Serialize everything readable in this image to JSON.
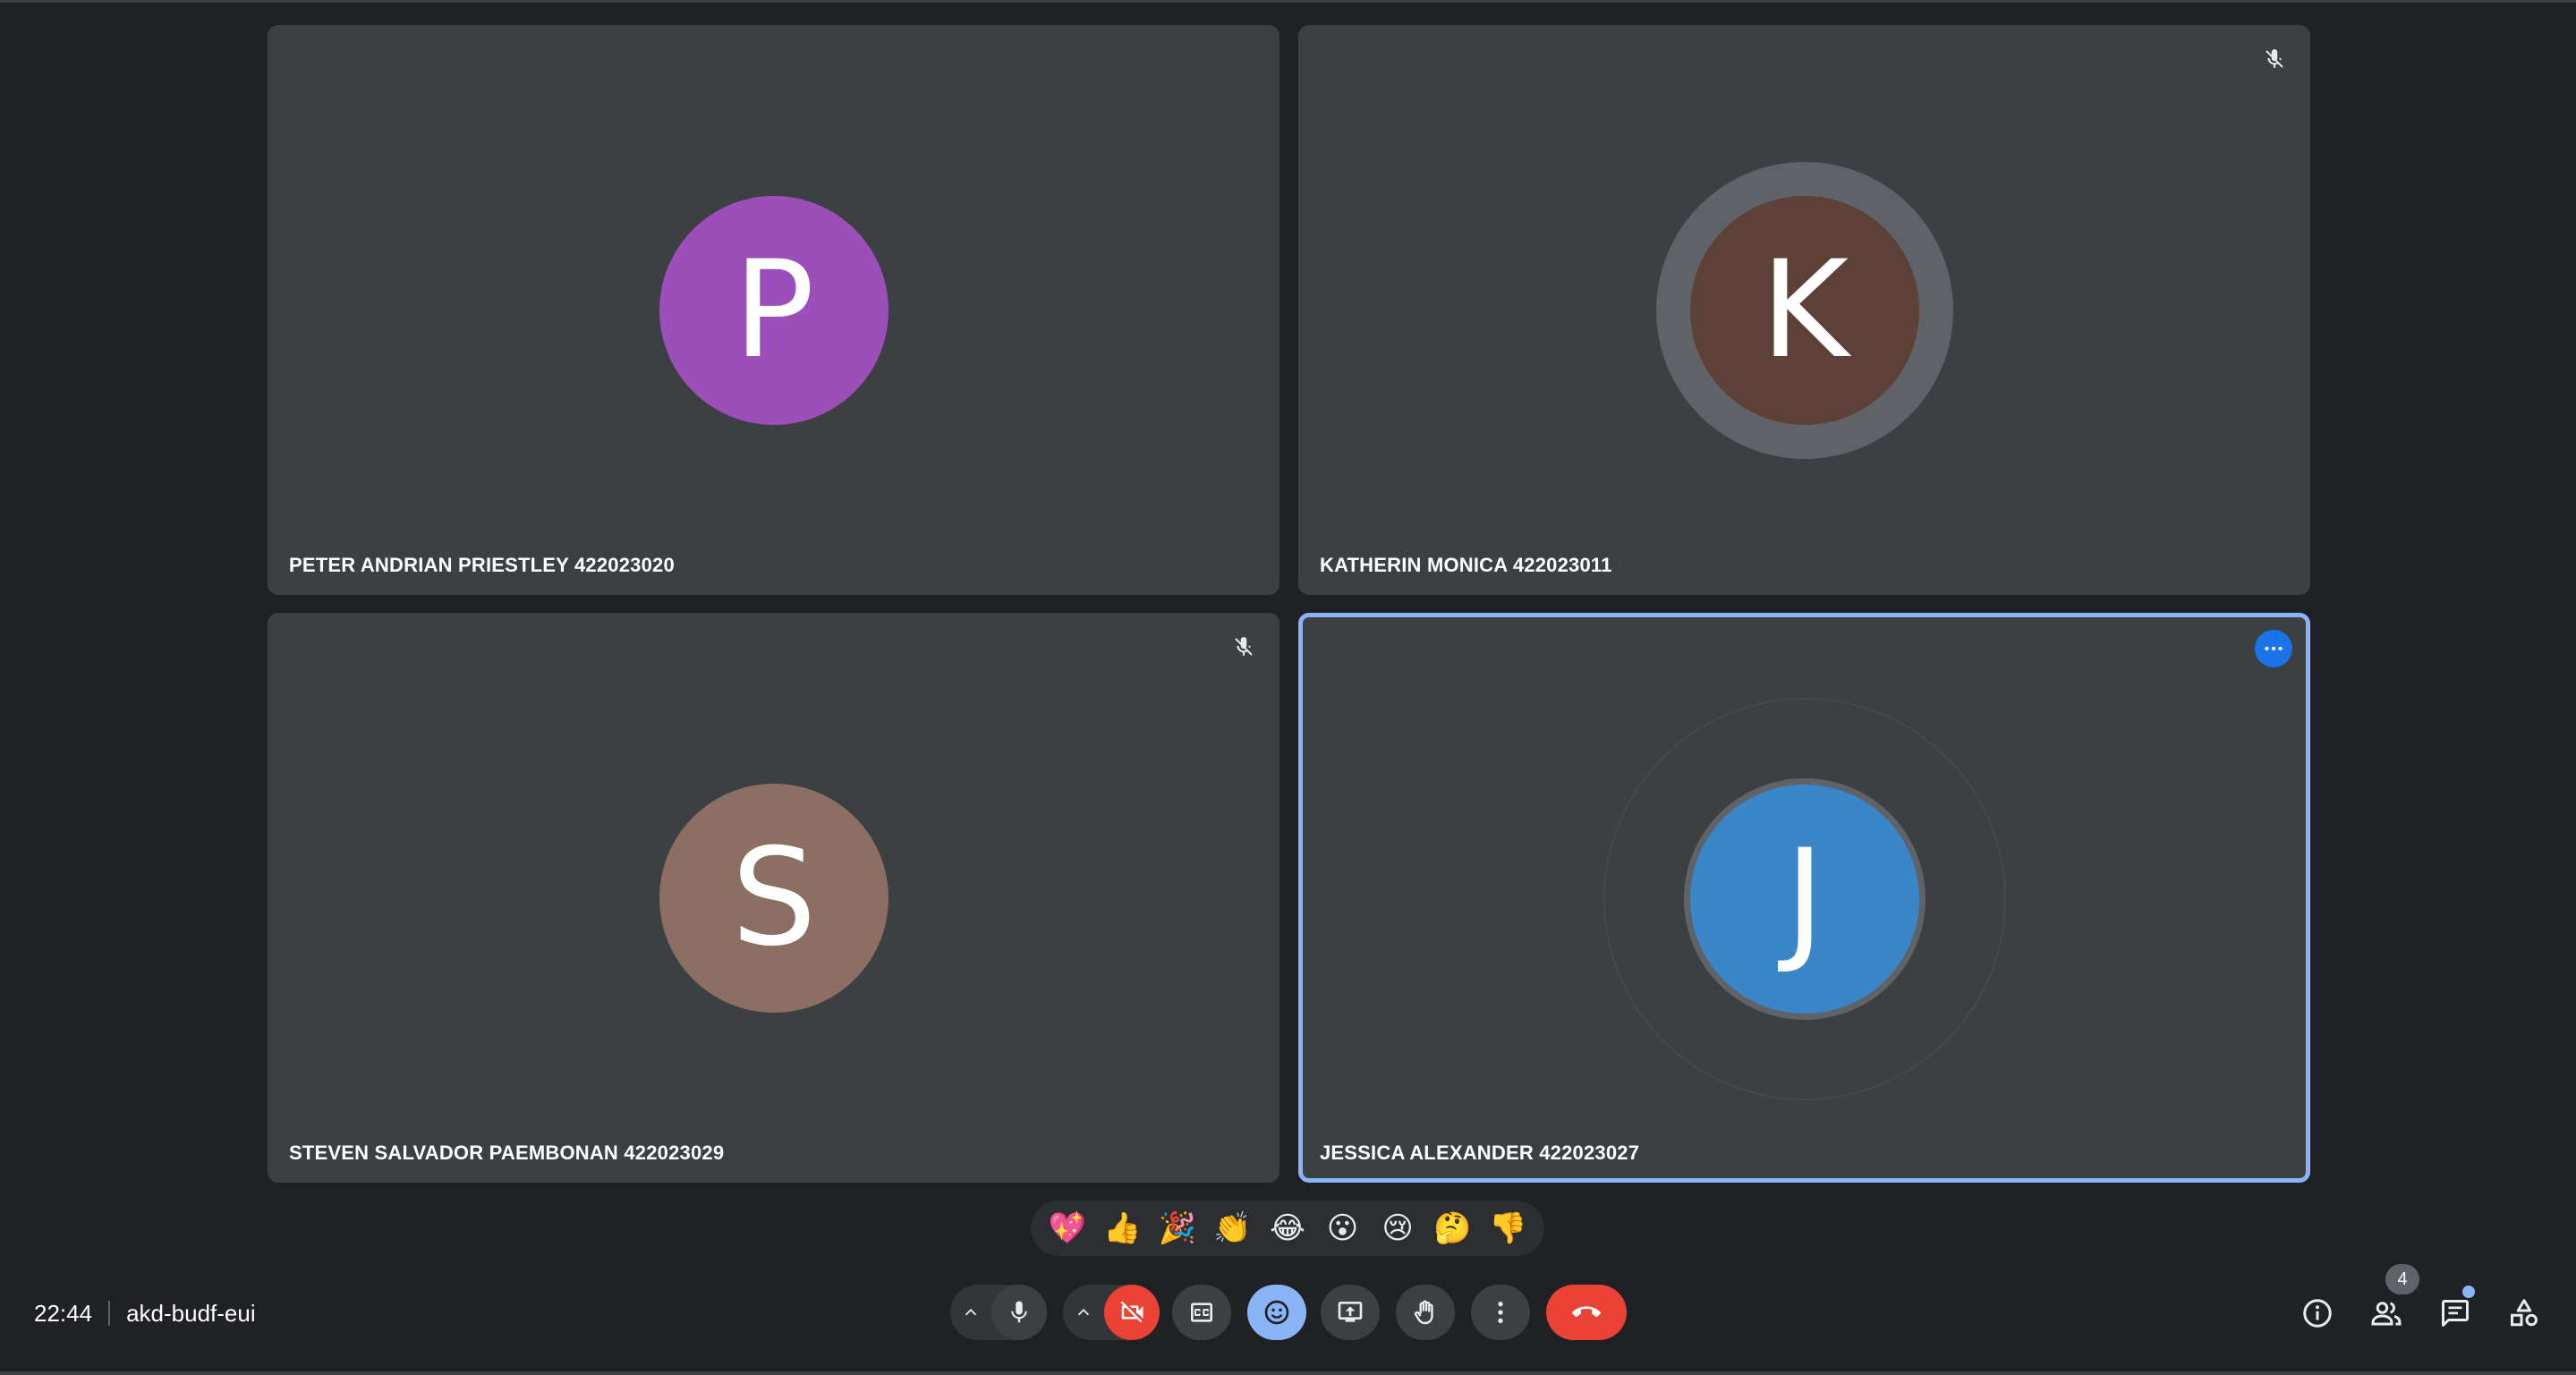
{
  "participants": [
    {
      "name": "PETER ANDRIAN PRIESTLEY 422023020",
      "initial": "P",
      "color": "#9c4fb8",
      "muted": false
    },
    {
      "name": "KATHERIN MONICA 422023011",
      "initial": "K",
      "color": "#5d4037",
      "muted": true,
      "speaking": true
    },
    {
      "name": "STEVEN SALVADOR PAEMBONAN 422023029",
      "initial": "S",
      "color": "#8d6e63",
      "muted": true
    },
    {
      "name": "JESSICA ALEXANDER 422023027",
      "initial": "J",
      "color": "#3a86c8",
      "muted": false,
      "pinned_focus": true
    }
  ],
  "reactions": [
    "💖",
    "👍",
    "🎉",
    "👏",
    "😂",
    "😮",
    "😢",
    "🤔",
    "👎"
  ],
  "meeting": {
    "time": "22:44",
    "code": "akd-budf-eui"
  },
  "people_count": "4",
  "colors": {
    "background": "#202124",
    "tile": "#3c4043",
    "accent": "#8ab4f8",
    "danger": "#ea4335"
  },
  "controls": [
    "mic-toggle",
    "camera-off",
    "captions",
    "emoji",
    "present",
    "raise-hand",
    "more-options",
    "leave-call"
  ],
  "right_controls": [
    "meeting-info-icon",
    "people-icon",
    "chat-icon",
    "activities-icon"
  ]
}
